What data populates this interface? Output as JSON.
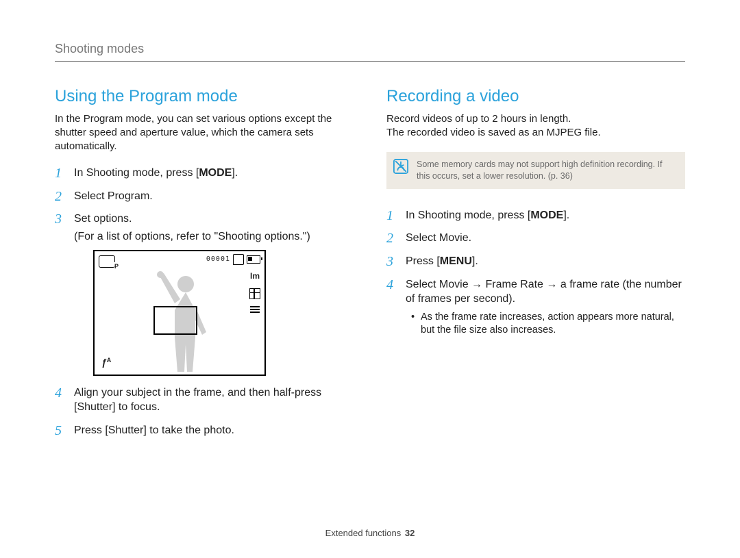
{
  "breadcrumb": "Shooting modes",
  "left": {
    "heading": "Using the Program mode",
    "intro": "In the Program mode, you can set various options except the shutter speed and aperture value, which the camera sets automatically.",
    "steps": [
      {
        "pre": "In Shooting mode, press [",
        "kbd": "MODE",
        "post": "]."
      },
      {
        "text": "Select Program."
      },
      {
        "text": "Set options.",
        "sub_pre": "(For a list of options, refer to \"",
        "sub_link": "Shooting options",
        "sub_post": ".\")"
      },
      {
        "text": "Align your subject in the frame, and then half-press [Shutter] to focus."
      },
      {
        "text": "Press [Shutter] to take the photo."
      }
    ],
    "preview": {
      "counter": "00001",
      "size_label": "Im",
      "flash_label": "ƒ",
      "flash_sup": "A"
    }
  },
  "right": {
    "heading": "Recording  a video",
    "intro": "Record videos of up to 2 hours in length.\nThe recorded video is saved as an MJPEG file.",
    "note": "Some memory cards may not support high definition recording. If this occurs, set a lower resolution. (p. 36)",
    "steps": [
      {
        "pre": "In Shooting mode, press [",
        "kbd": "MODE",
        "post": "]."
      },
      {
        "text": "Select Movie."
      },
      {
        "pre": "Press [",
        "kbd": "MENU",
        "post": "]."
      },
      {
        "text": "Select Movie → Frame Rate → a frame rate (the number of frames per second).",
        "bullet": "As the frame rate increases, action appears more natural, but the file size also increases."
      }
    ]
  },
  "footer": {
    "section": "Extended functions",
    "page": "32"
  }
}
